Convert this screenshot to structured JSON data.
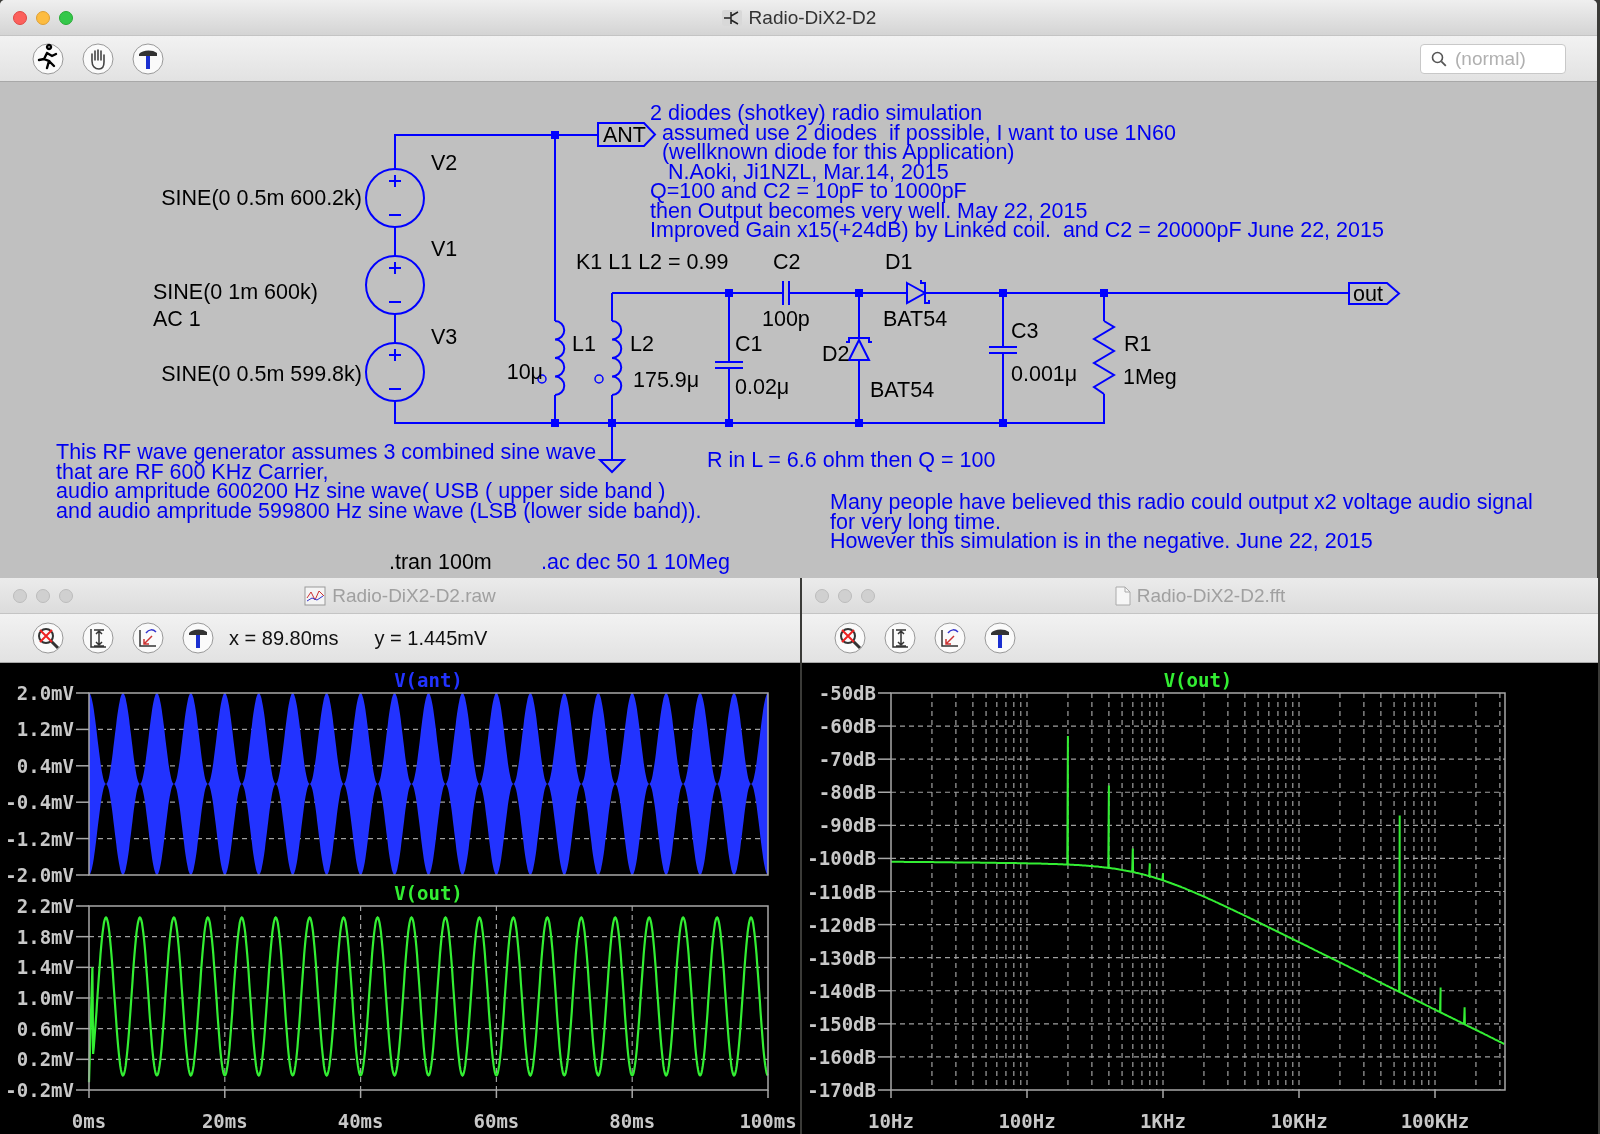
{
  "schematic_window": {
    "title": "Radio-DiX2-D2",
    "active": true,
    "search": {
      "placeholder": "(normal)"
    },
    "components": [
      {
        "kind": "voltage_source",
        "name": "V2",
        "values": [
          "SINE(0 0.5m 600.2k)"
        ]
      },
      {
        "kind": "voltage_source",
        "name": "V1",
        "values": [
          "SINE(0 1m 600k)",
          "AC 1"
        ]
      },
      {
        "kind": "voltage_source",
        "name": "V3",
        "values": [
          "SINE(0 0.5m 599.8k)"
        ]
      },
      {
        "kind": "inductor",
        "name": "L1",
        "values": [
          "10μ"
        ]
      },
      {
        "kind": "inductor",
        "name": "L2",
        "values": [
          "175.9μ"
        ]
      },
      {
        "kind": "capacitor",
        "name": "C1",
        "values": [
          "0.02μ"
        ]
      },
      {
        "kind": "capacitor",
        "name": "C2",
        "values": [
          "100p"
        ]
      },
      {
        "kind": "diode",
        "name": "D1",
        "values": [
          "BAT54"
        ]
      },
      {
        "kind": "diode",
        "name": "D2",
        "values": [
          "BAT54"
        ]
      },
      {
        "kind": "capacitor",
        "name": "C3",
        "values": [
          "0.001μ"
        ]
      },
      {
        "kind": "resistor",
        "name": "R1",
        "values": [
          "1Meg"
        ]
      }
    ],
    "ports": [
      {
        "label": "ANT"
      },
      {
        "label": "out"
      }
    ],
    "annotations": [
      {
        "kind": "comment",
        "lines": [
          "2 diodes (shotkey) radio simulation",
          "  assumed use 2 diodes  if possible, I want to use 1N60",
          "  (wellknown diode for this Application)",
          "   N.Aoki, Ji1NZL, Mar.14, 2015",
          "Q=100 and C2 = 10pF to 1000pF",
          "then Output becomes very well. May 22, 2015",
          "Improved Gain x15(+24dB) by Linked coil.  and C2 = 20000pF June 22, 2015"
        ]
      },
      {
        "kind": "directive",
        "lines": [
          "K1 L1 L2 = 0.99"
        ]
      },
      {
        "kind": "comment",
        "lines": [
          "This RF wave generator assumes 3 combined sine wave",
          "that are RF 600 KHz Carrier,"
        ]
      },
      {
        "kind": "comment",
        "lines": [
          "audio ampritude 600200 Hz sine wave( USB ( upper side band )",
          "and audio ampritude 599800 Hz sine wave (LSB (lower side band))."
        ]
      },
      {
        "kind": "comment",
        "lines": [
          "R in L = 6.6 ohm then Q = 100"
        ]
      },
      {
        "kind": "comment",
        "lines": [
          "Many people have believed this radio could output x2 voltage audio signal",
          "for very long time.",
          "However this simulation is in the negative. June 22, 2015"
        ]
      },
      {
        "kind": "directive",
        "lines": [
          ".tran 100m"
        ]
      },
      {
        "kind": "comment",
        "lines": [
          ".ac dec 50 1 10Meg"
        ]
      }
    ]
  },
  "waveform_window": {
    "title": "Radio-DiX2-D2.raw",
    "active": false,
    "cursor_x": "x = 89.80ms",
    "cursor_y": "y = 1.445mV",
    "panes": [
      {
        "kind": "envelope",
        "trace": "V(ant)",
        "color": "#2233ff",
        "y_ticks": [
          "2.0mV",
          "1.2mV",
          "0.4mV",
          "-0.4mV",
          "-1.2mV",
          "-2.0mV"
        ]
      },
      {
        "kind": "detected",
        "trace": "V(out)",
        "color": "#33ee33",
        "y_ticks": [
          "2.2mV",
          "1.8mV",
          "1.4mV",
          "1.0mV",
          "0.6mV",
          "0.2mV",
          "-0.2mV"
        ]
      }
    ],
    "x_ticks": [
      "0ms",
      "20ms",
      "40ms",
      "60ms",
      "80ms",
      "100ms"
    ]
  },
  "fft_window": {
    "title": "Radio-DiX2-D2.fft",
    "active": false,
    "panes": [
      {
        "kind": "spectrum",
        "trace": "V(out)",
        "color": "#33ee33",
        "y_ticks": [
          "-50dB",
          "-60dB",
          "-70dB",
          "-80dB",
          "-90dB",
          "-100dB",
          "-110dB",
          "-120dB",
          "-130dB",
          "-140dB",
          "-150dB",
          "-160dB",
          "-170dB"
        ]
      }
    ],
    "x_ticks": [
      "10Hz",
      "100Hz",
      "1KHz",
      "10KHz",
      "100KHz"
    ]
  }
}
